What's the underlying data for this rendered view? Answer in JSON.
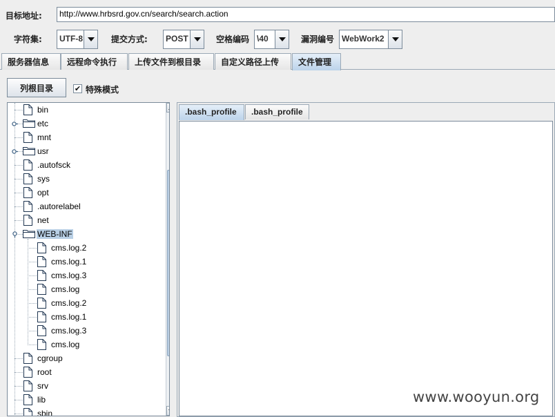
{
  "form": {
    "target_label": "目标地址:",
    "target_value": "http://www.hrbsrd.gov.cn/search/search.action",
    "charset_label": "字符集:",
    "charset_value": "UTF-8",
    "method_label": "提交方式:",
    "method_value": "POST",
    "space_label": "空格编码",
    "space_value": "\\40",
    "vuln_label": "漏洞编号",
    "vuln_value": "WebWork2"
  },
  "tabs": [
    {
      "label": "服务器信息",
      "active": false
    },
    {
      "label": "远程命令执行",
      "active": false
    },
    {
      "label": "上传文件到根目录",
      "active": false
    },
    {
      "label": "自定义路径上传",
      "active": false
    },
    {
      "label": "文件管理",
      "active": true
    }
  ],
  "file_manager": {
    "list_root_label": "列根目录",
    "special_mode_label": "特殊模式",
    "special_mode_checked": true,
    "tree": [
      {
        "name": "bin",
        "type": "file",
        "depth": 0
      },
      {
        "name": "etc",
        "type": "folder",
        "depth": 0,
        "collapsed": true
      },
      {
        "name": "mnt",
        "type": "file",
        "depth": 0
      },
      {
        "name": "usr",
        "type": "folder",
        "depth": 0,
        "collapsed": true
      },
      {
        "name": ".autofsck",
        "type": "file",
        "depth": 0
      },
      {
        "name": "sys",
        "type": "file",
        "depth": 0
      },
      {
        "name": "opt",
        "type": "file",
        "depth": 0
      },
      {
        "name": ".autorelabel",
        "type": "file",
        "depth": 0
      },
      {
        "name": "net",
        "type": "file",
        "depth": 0
      },
      {
        "name": "WEB-INF",
        "type": "folder",
        "depth": 0,
        "expanded": true,
        "selected": true
      },
      {
        "name": "cms.log.2",
        "type": "file",
        "depth": 1
      },
      {
        "name": "cms.log.1",
        "type": "file",
        "depth": 1
      },
      {
        "name": "cms.log.3",
        "type": "file",
        "depth": 1
      },
      {
        "name": "cms.log",
        "type": "file",
        "depth": 1
      },
      {
        "name": "cms.log.2",
        "type": "file",
        "depth": 1
      },
      {
        "name": "cms.log.1",
        "type": "file",
        "depth": 1
      },
      {
        "name": "cms.log.3",
        "type": "file",
        "depth": 1
      },
      {
        "name": "cms.log",
        "type": "file",
        "depth": 1
      },
      {
        "name": "cgroup",
        "type": "file",
        "depth": 0
      },
      {
        "name": "root",
        "type": "file",
        "depth": 0
      },
      {
        "name": "srv",
        "type": "file",
        "depth": 0
      },
      {
        "name": "lib",
        "type": "file",
        "depth": 0
      },
      {
        "name": "sbin",
        "type": "file",
        "depth": 0
      }
    ],
    "editor_tabs": [
      {
        "label": ".bash_profile",
        "active": true
      },
      {
        "label": ".bash_profile",
        "active": false
      }
    ],
    "editor_content": ""
  },
  "watermark": "www.wooyun.org",
  "colors": {
    "selection": "#b8cfe5",
    "active_tab": "#bcd3ea",
    "border": "#7a8a99"
  }
}
